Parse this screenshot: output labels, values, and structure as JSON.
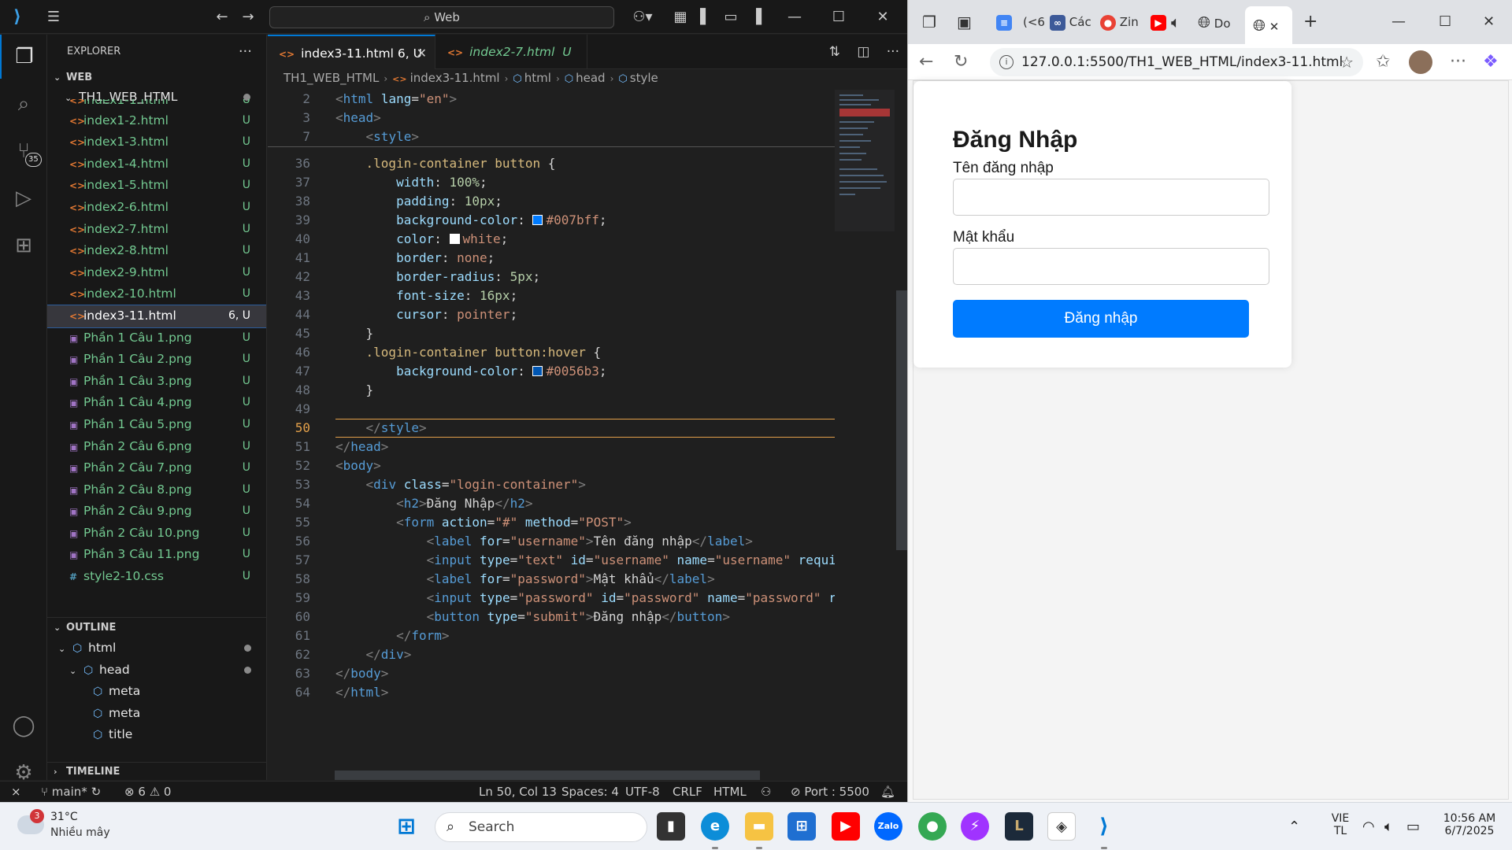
{
  "vscode": {
    "command_center": "Web",
    "explorer_title": "EXPLORER",
    "workspace": "WEB",
    "folder": "TH1_WEB_HTML",
    "files": [
      {
        "name": "index1-1.html",
        "status": "U",
        "icon": "<>"
      },
      {
        "name": "index1-2.html",
        "status": "U",
        "icon": "<>"
      },
      {
        "name": "index1-3.html",
        "status": "U",
        "icon": "<>"
      },
      {
        "name": "index1-4.html",
        "status": "U",
        "icon": "<>"
      },
      {
        "name": "index1-5.html",
        "status": "U",
        "icon": "<>"
      },
      {
        "name": "index2-6.html",
        "status": "U",
        "icon": "<>"
      },
      {
        "name": "index2-7.html",
        "status": "U",
        "icon": "<>"
      },
      {
        "name": "index2-8.html",
        "status": "U",
        "icon": "<>"
      },
      {
        "name": "index2-9.html",
        "status": "U",
        "icon": "<>"
      },
      {
        "name": "index2-10.html",
        "status": "U",
        "icon": "<>"
      },
      {
        "name": "index3-11.html",
        "status": "6, U",
        "icon": "<>"
      },
      {
        "name": "Phần 1 Câu 1.png",
        "status": "U",
        "icon": "img"
      },
      {
        "name": "Phần 1 Câu 2.png",
        "status": "U",
        "icon": "img"
      },
      {
        "name": "Phần 1 Câu 3.png",
        "status": "U",
        "icon": "img"
      },
      {
        "name": "Phần 1 Câu 4.png",
        "status": "U",
        "icon": "img"
      },
      {
        "name": "Phần 1 Câu 5.png",
        "status": "U",
        "icon": "img"
      },
      {
        "name": "Phần 2 Câu 6.png",
        "status": "U",
        "icon": "img"
      },
      {
        "name": "Phần 2 Câu 7.png",
        "status": "U",
        "icon": "img"
      },
      {
        "name": "Phần 2 Câu 8.png",
        "status": "U",
        "icon": "img"
      },
      {
        "name": "Phần 2 Câu 9.png",
        "status": "U",
        "icon": "img"
      },
      {
        "name": "Phần 2 Câu 10.png",
        "status": "U",
        "icon": "img"
      },
      {
        "name": "Phần 3 Câu 11.png",
        "status": "U",
        "icon": "img"
      },
      {
        "name": "style2-10.css",
        "status": "U",
        "icon": "#"
      }
    ],
    "outline_title": "OUTLINE",
    "outline": [
      "html",
      "head",
      "meta",
      "meta",
      "title"
    ],
    "timeline_title": "TIMELINE",
    "tabs": [
      {
        "label": "index3-11.html",
        "badge": "6, U"
      },
      {
        "label": "index2-7.html",
        "badge": "U"
      }
    ],
    "breadcrumb": [
      "TH1_WEB_HTML",
      "index3-11.html",
      "html",
      "head",
      "style"
    ],
    "status": {
      "branch": "main*",
      "errors": "6",
      "warnings": "0",
      "position": "Ln 50, Col 13",
      "spaces": "Spaces: 4",
      "encoding": "UTF-8",
      "eol": "CRLF",
      "language": "HTML",
      "port": "Port : 5500"
    },
    "activity_badge": "35"
  },
  "browser": {
    "url": "127.0.0.1:5500/TH1_WEB_HTML/index3-11.html",
    "tabs": [
      "(<6",
      "Các",
      "Zin",
      "Do"
    ],
    "login": {
      "title": "Đăng Nhập",
      "username_label": "Tên đăng nhập",
      "password_label": "Mật khẩu",
      "button": "Đăng nhập"
    }
  },
  "taskbar": {
    "temperature": "31°C",
    "weather": "Nhiều mây",
    "weather_badge": "3",
    "search": "Search",
    "lang": "VIE",
    "lang2": "TL",
    "time": "10:56 AM",
    "date": "6/7/2025"
  },
  "colors": {
    "vscode_bg": "#1f1f1f",
    "accent": "#0078d4",
    "git_untracked": "#73c991",
    "login_button": "#007bff"
  }
}
